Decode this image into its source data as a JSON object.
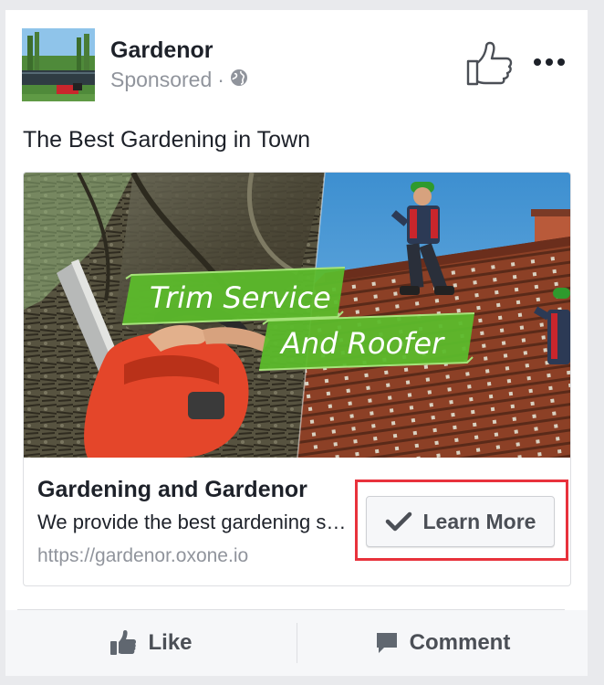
{
  "post": {
    "page_name": "Gardenor",
    "sponsored_label": "Sponsored",
    "separator": "·",
    "caption": "The Best Gardening in Town"
  },
  "ad_card": {
    "banner_line1": "Trim Service",
    "banner_line2": "And Roofer",
    "title": "Gardening and Gardenor",
    "description": "We provide the best gardening services in town",
    "url": "https://gardenor.oxone.io",
    "cta_label": "Learn More"
  },
  "actions": {
    "like_label": "Like",
    "comment_label": "Comment"
  },
  "icons": {
    "globe": "globe-icon",
    "thumbs_up": "thumbs-up-icon",
    "more": "more-options-icon",
    "check": "check-icon",
    "comment": "comment-icon"
  },
  "colors": {
    "highlight_border": "#e8323c",
    "banner_green": "#5cbb2b",
    "text_primary": "#1d2129",
    "text_secondary": "#90949c"
  }
}
